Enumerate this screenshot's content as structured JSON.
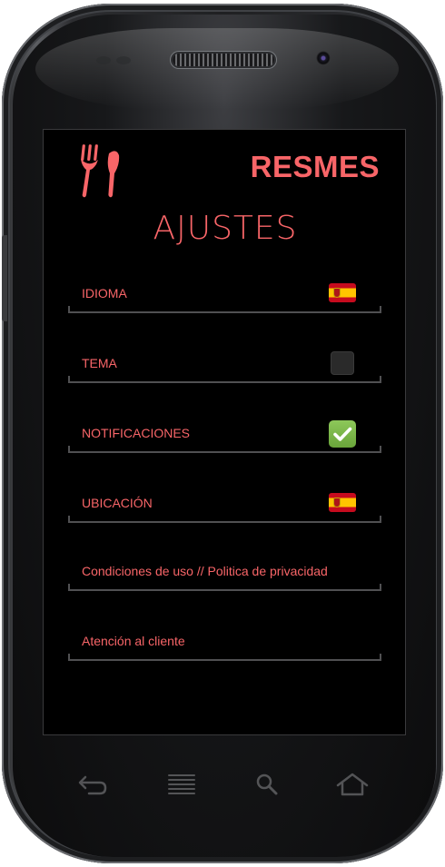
{
  "app": {
    "brand": "RESMES",
    "logo_icon": "fork-knife-icon"
  },
  "page": {
    "title": "AJUSTES"
  },
  "settings": [
    {
      "label": "IDIOMA",
      "control": "flag-spain-icon"
    },
    {
      "label": "TEMA",
      "control": "checkbox",
      "checked": false
    },
    {
      "label": "NOTIFICACIONES",
      "control": "checkbox",
      "checked": true
    },
    {
      "label": "UBICACIÓN",
      "control": "flag-spain-icon"
    },
    {
      "label": "Condiciones de uso // Politica de privacidad",
      "control": "none"
    },
    {
      "label": "Atención al cliente",
      "control": "none"
    }
  ],
  "nav": {
    "icons": [
      "back-icon",
      "menu-icon",
      "search-icon",
      "home-icon"
    ]
  },
  "colors": {
    "accent": "#f86568",
    "background": "#000000",
    "divider": "#505052",
    "check_green": "#78b446"
  }
}
